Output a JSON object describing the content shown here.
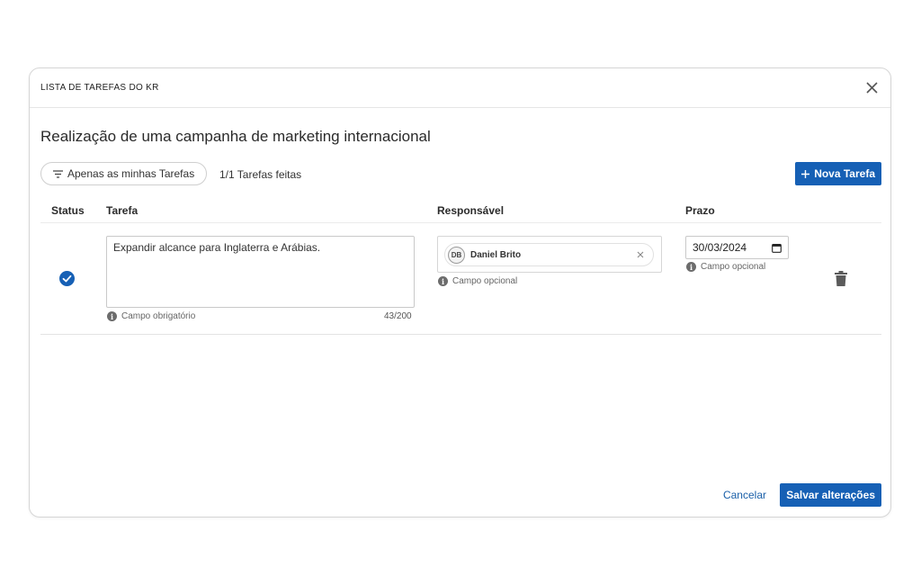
{
  "modal": {
    "title": "LISTA DE TAREFAS DO KR",
    "page_title": "Realização de uma campanha de marketing internacional"
  },
  "toolbar": {
    "filter_label": "Apenas as minhas Tarefas",
    "done_count": "1/1 Tarefas feitas",
    "new_task_label": "Nova Tarefa"
  },
  "table": {
    "columns": [
      "Status",
      "Tarefa",
      "Responsável",
      "Prazo"
    ],
    "rows": [
      {
        "status": "done",
        "task": "Expandir alcance para Inglaterra e Arábias.",
        "task_hint": "Campo obrigatório",
        "task_count": "43/200",
        "assignee_initials": "DB",
        "assignee_name": "Daniel Brito",
        "assignee_hint": "Campo opcional",
        "deadline": "30/03/2024",
        "deadline_hint": "Campo opcional"
      }
    ]
  },
  "footer": {
    "cancel_label": "Cancelar",
    "save_label": "Salvar alterações"
  },
  "icons": {
    "close": "close-icon",
    "filter": "filter-icon",
    "plus": "plus-icon",
    "status": "check-circle-icon",
    "info": "info-icon",
    "chip_remove": "close-icon",
    "calendar": "calendar-icon",
    "delete": "trash-icon"
  },
  "colors": {
    "primary": "#1660b5",
    "link": "#1a5fa8",
    "border": "#d6d6d6"
  }
}
